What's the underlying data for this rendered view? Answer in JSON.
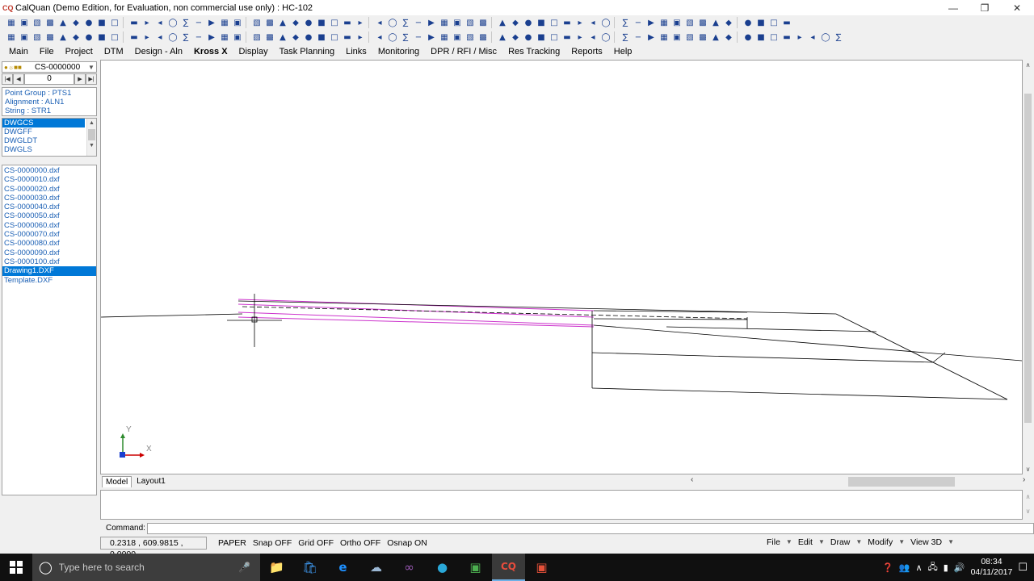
{
  "window": {
    "title": "CalQuan (Demo Edition, for Evaluation, non commercial use only) :  HC-102",
    "app_icon": "CQ"
  },
  "toolbar1_icons": [
    "new-icon",
    "open-icon",
    "save-icon",
    "print-icon",
    "undo-icon",
    "redo-icon",
    "cut-icon",
    "copy-icon",
    "paste-icon",
    "zoom-icon",
    "pan-icon",
    "line-icon",
    "polyline-icon",
    "circle-icon",
    "arc-icon",
    "rectangle-icon",
    "text-icon",
    "dimension-icon",
    "layer-icon",
    "grid-icon",
    "snap-icon",
    "measure-icon",
    "delete-icon"
  ],
  "toolbar2_icons": [
    "folder-icon",
    "save-icon",
    "print-icon",
    "preview-icon",
    "layer-icon",
    "properties-icon",
    "zoom-in-icon",
    "zoom-out-icon",
    "zoom-extents-icon",
    "pan-icon",
    "refresh-icon",
    "settings-icon"
  ],
  "menu": [
    "Main",
    "File",
    "Project",
    "DTM",
    "Design - Aln",
    "Kross X",
    "Display",
    "Task Planning",
    "Links",
    "Monitoring",
    "DPR / RFI / Misc",
    "Res Tracking",
    "Reports",
    "Help"
  ],
  "left": {
    "combo_value": "CS-0000000",
    "nav_value": "0",
    "info": [
      "Point Group : PTS1",
      "Alignment : ALN1",
      "String : STR1"
    ],
    "layers": [
      "DWGCS",
      "DWGFF",
      "DWGLDT",
      "DWGLS"
    ],
    "selected_layer": "DWGCS",
    "files": [
      "CS-0000000.dxf",
      "CS-0000010.dxf",
      "CS-0000020.dxf",
      "CS-0000030.dxf",
      "CS-0000040.dxf",
      "CS-0000050.dxf",
      "CS-0000060.dxf",
      "CS-0000070.dxf",
      "CS-0000080.dxf",
      "CS-0000090.dxf",
      "CS-0000100.dxf",
      "Drawing1.DXF",
      "Template.DXF"
    ],
    "selected_file": "Drawing1.DXF"
  },
  "ucs": {
    "y_label": "Y",
    "x_label": "X"
  },
  "tabs": [
    "Model",
    "Layout1"
  ],
  "active_tab": "Model",
  "command": {
    "label": "Command:",
    "value": ""
  },
  "status": {
    "coords": "0.2318 , 609.9815 , 0.0000",
    "toggles": [
      "PAPER",
      "Snap OFF",
      "Grid OFF",
      "Ortho OFF",
      "Osnap ON"
    ],
    "right_menu": [
      "File",
      "Edit",
      "Draw",
      "Modify",
      "View 3D"
    ]
  },
  "taskbar": {
    "search_placeholder": "Type here to search",
    "time": "08:34",
    "date": "04/11/2017"
  },
  "colors": {
    "accent": "#0078d7",
    "link": "#1a5fb4",
    "magenta": "#cc33cc",
    "taskbar": "#101010"
  }
}
